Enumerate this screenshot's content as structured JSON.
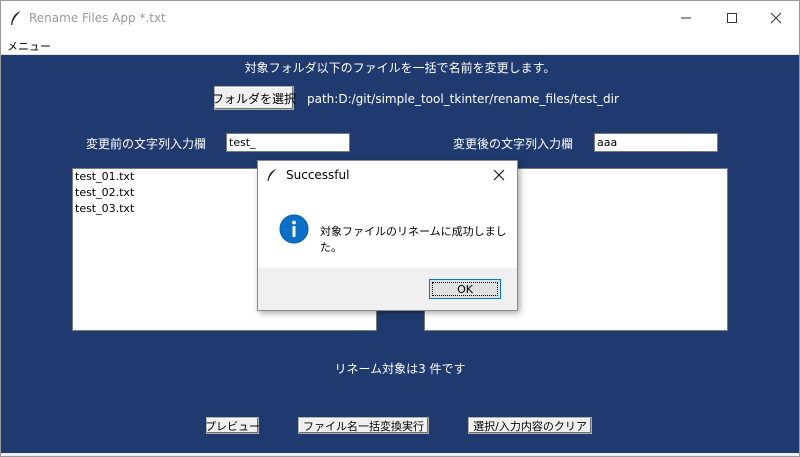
{
  "window": {
    "title": "Rename Files App *.txt"
  },
  "menu": {
    "label": "メニュー"
  },
  "main": {
    "description": "対象フォルダ以下のファイルを一括で名前を変更します。",
    "select_folder_label": "フォルダを選択",
    "path_text": "path:D:/git/simple_tool_tkinter/rename_files/test_dir",
    "before_label": "変更前の文字列入力欄",
    "before_value": "test_",
    "after_label": "変更後の文字列入力欄",
    "after_value": "aaa",
    "file_list": [
      "test_01.txt",
      "test_02.txt",
      "test_03.txt"
    ],
    "status_text": "リネーム対象は3 件です",
    "preview_label": "プレビュー",
    "execute_label": "ファイル名一括変換実行",
    "clear_label": "選択/入力内容のクリア"
  },
  "dialog": {
    "title": "Successful",
    "message": "対象ファイルのリネームに成功しました。",
    "ok_label": "OK",
    "info_color": "#0a6fc9"
  },
  "colors": {
    "main_background": "#1f3a6e"
  }
}
